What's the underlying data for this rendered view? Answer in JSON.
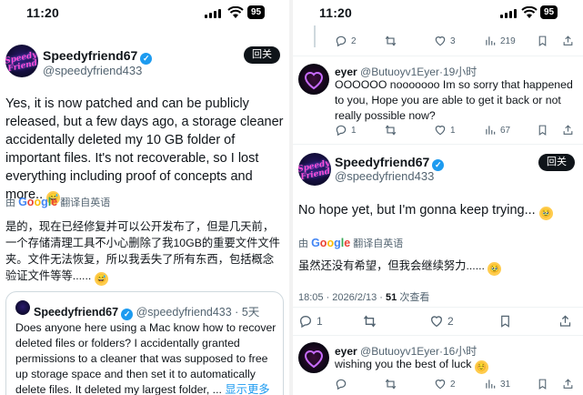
{
  "status_bar": {
    "time": "11:20",
    "battery": "95"
  },
  "left": {
    "author": {
      "name": "Speedyfriend67",
      "handle": "@speedyfriend433",
      "avatar_text": "Speedy Friend"
    },
    "follow_button": "回关",
    "post_text": "Yes, it is now patched and can be publicly released, but a few days ago, a storage cleaner accidentally deleted my 10 GB folder of important files. It's not recoverable, so I lost everything including proof of concepts and more..",
    "post_emoji": "😅",
    "translate_prefix": "由",
    "translate_brand": "Google",
    "translate_label": "翻译自英语",
    "translation": "是的，现在已经修复并可以公开发布了，但是几天前，一个存储清理工具不小心删除了我10GB的重要文件文件夹。文件无法恢复，所以我丢失了所有东西，包括概念验证文件等等......",
    "translation_emoji": "😅",
    "quote": {
      "name": "Speedyfriend67",
      "handle": "@speedyfriend433",
      "time": "5天",
      "text": "Does anyone here using a Mac know how to recover deleted files or folders? I accidentally granted permissions to a cleaner that was supposed to free up storage space and then set it to automatically delete files. It deleted my largest folder, ...",
      "show_more": "显示更多"
    }
  },
  "right": {
    "top_actions": {
      "replies": "2",
      "reposts": "",
      "likes": "3",
      "views": "219"
    },
    "reply1": {
      "name": "eyer",
      "handle": "@Butuoyv1Eyer",
      "time": "19小时",
      "text": "OOOOOO nooooooo Im so sorry that happened to you, Hope you are able to get it back or not really possible now?",
      "actions": {
        "replies": "1",
        "reposts": "",
        "likes": "1",
        "views": "67"
      }
    },
    "main": {
      "name": "Speedyfriend67",
      "handle": "@speedyfriend433",
      "follow_button": "回关",
      "text": "No hope yet, but I'm gonna keep trying...",
      "emoji": "🥹",
      "translate_prefix": "由",
      "translate_brand": "Google",
      "translate_label": "翻译自英语",
      "translation": "虽然还没有希望，但我会继续努力......",
      "translation_emoji": "🥹",
      "timestamp": "18:05 · 2026/2/13 · ",
      "views_count": "51",
      "views_label": "次查看",
      "actions": {
        "replies": "1",
        "reposts": "",
        "likes": "2",
        "bookmarks": ""
      }
    },
    "reply2": {
      "name": "eyer",
      "handle": "@Butuoyv1Eyer",
      "time": "16小时",
      "text": "wishing you the best of luck",
      "emoji": "☺️",
      "actions": {
        "replies": "",
        "reposts": "",
        "likes": "2",
        "views": "31"
      }
    }
  },
  "colors": {
    "accent": "#1d9bf0",
    "text": "#0f1419",
    "secondary": "#536471",
    "border": "#cfd9de"
  },
  "icons": [
    "signal-icon",
    "wifi-icon",
    "battery-icon",
    "verified-icon",
    "google-logo",
    "reply-icon",
    "repost-icon",
    "like-icon",
    "views-icon",
    "bookmark-icon",
    "share-icon"
  ]
}
